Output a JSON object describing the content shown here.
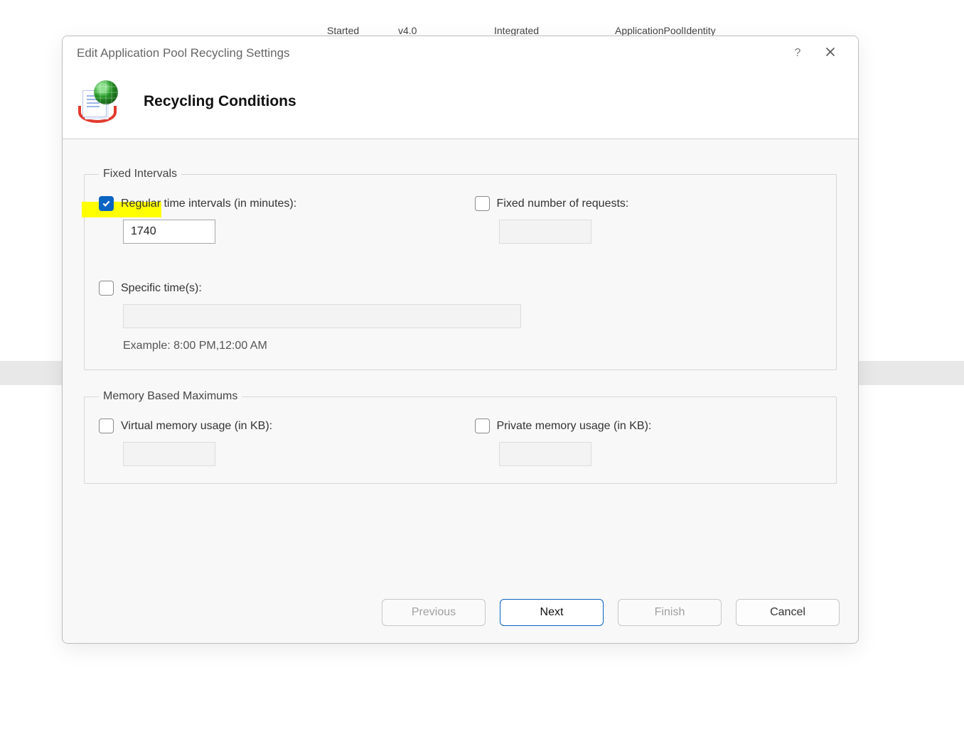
{
  "background": {
    "col_started": "Started",
    "col_version": "v4.0",
    "col_mode": "Integrated",
    "col_identity": "ApplicationPoolIdentity"
  },
  "dialog": {
    "title": "Edit Application Pool Recycling Settings",
    "heading": "Recycling Conditions"
  },
  "groups": {
    "fixed": {
      "legend": "Fixed Intervals",
      "regular_label": "Regular time intervals (in minutes):",
      "regular_checked": true,
      "regular_value": "1740",
      "fixed_requests_label": "Fixed number of requests:",
      "fixed_requests_checked": false,
      "fixed_requests_value": "",
      "specific_label": "Specific time(s):",
      "specific_checked": false,
      "specific_value": "",
      "specific_hint": "Example: 8:00 PM,12:00 AM"
    },
    "memory": {
      "legend": "Memory Based Maximums",
      "virtual_label": "Virtual memory usage (in KB):",
      "virtual_checked": false,
      "virtual_value": "",
      "private_label": "Private memory usage (in KB):",
      "private_checked": false,
      "private_value": ""
    }
  },
  "buttons": {
    "previous": "Previous",
    "next": "Next",
    "finish": "Finish",
    "cancel": "Cancel"
  },
  "icons": {
    "help": "?",
    "close": "close"
  }
}
